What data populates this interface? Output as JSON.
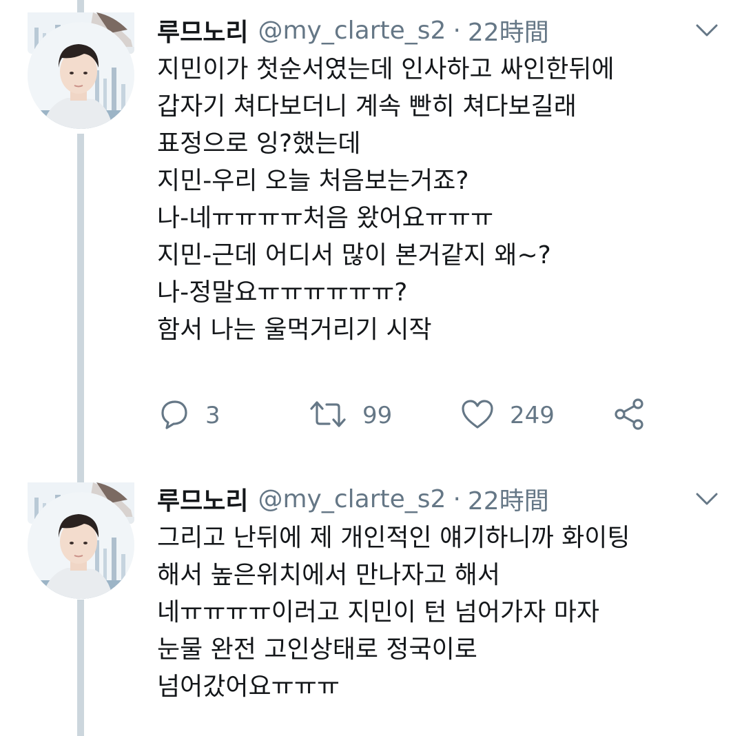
{
  "tweets": [
    {
      "name": "루므노리",
      "handle": "@my_clarte_s2",
      "separator": "·",
      "time": "22時間",
      "lines": [
        "지민이가 첫순서였는데 인사하고 싸인한뒤에",
        "갑자기 쳐다보더니 계속 빤히 쳐다보길래",
        "표정으로 잉?했는데",
        "지민-우리 오늘 처음보는거죠?",
        "나-네ㅠㅠㅠㅠ처음 왔어요ㅠㅠㅠ",
        "지민-근데 어디서 많이 본거같지 왜~?",
        "나-정말요ㅠㅠㅠㅠㅠㅠ?",
        "함서 나는 울먹거리기 시작"
      ],
      "actions": {
        "reply_icon": "reply-icon",
        "reply_count": "3",
        "retweet_icon": "retweet-icon",
        "retweet_count": "99",
        "like_icon": "heart-icon",
        "like_count": "249",
        "share_icon": "share-icon"
      }
    },
    {
      "name": "루므노리",
      "handle": "@my_clarte_s2",
      "separator": "·",
      "time": "22時間",
      "lines": [
        "그리고 난뒤에 제 개인적인 얘기하니까 화이팅",
        "해서 높은위치에서 만나자고 해서",
        "네ㅠㅠㅠㅠ이러고 지민이 턴 넘어가자 마자",
        "눈물 완전 고인상태로 정국이로",
        "넘어갔어요ㅠㅠㅠ"
      ]
    }
  ],
  "colors": {
    "text": "#14171a",
    "secondary": "#657786",
    "thread_line": "#ccd6dd",
    "background": "#ffffff"
  }
}
